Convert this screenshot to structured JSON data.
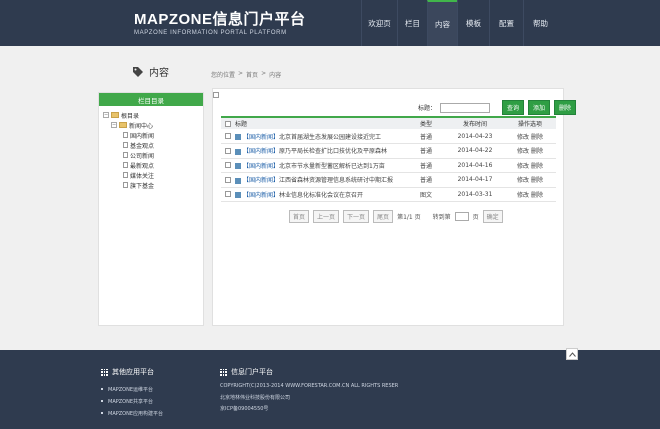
{
  "header": {
    "brand_title": "MAPZONE信息门户平台",
    "brand_subtitle": "MAPZONE INFORMATION PORTAL PLATFORM",
    "nav": [
      "欢迎页",
      "栏目",
      "内容",
      "模板",
      "配置",
      "帮助"
    ],
    "active_nav": "内容",
    "accent": "#41b64b"
  },
  "page": {
    "title": "内容",
    "breadcrumb": [
      "您的位置",
      ">",
      "首页",
      ">",
      "内容"
    ]
  },
  "sidebar": {
    "title": "栏目目录",
    "root": "根目录",
    "group": "新闻中心",
    "items": [
      "国内新闻",
      "基金观点",
      "公司新闻",
      "最新观点",
      "媒体关注",
      "旗下基金"
    ]
  },
  "toolbar": {
    "search_label": "标题：",
    "search_value": "",
    "query_label": "查询",
    "add_label": "添加",
    "delete_label": "删除"
  },
  "table": {
    "headers": [
      "",
      "标题",
      "类型",
      "发布时间",
      "操作选项"
    ],
    "rows": [
      {
        "category": "【国内新闻】",
        "title": "北京首届湖生态发展公园建设接近完工",
        "type": "普通",
        "date": "2014-04-23",
        "edit": "修改",
        "del": "删除"
      },
      {
        "category": "【国内新闻】",
        "title": "原乃平局长检查扩比口技优化及平原森林",
        "type": "普通",
        "date": "2014-04-22",
        "edit": "修改",
        "del": "删除"
      },
      {
        "category": "【国内新闻】",
        "title": "北京市节水量新型蓄区解析已达到1万亩",
        "type": "普通",
        "date": "2014-04-16",
        "edit": "修改",
        "del": "删除"
      },
      {
        "category": "【国内新闻】",
        "title": "江西省森林资源管理信息系统研讨中期汇报",
        "type": "普通",
        "date": "2014-04-17",
        "edit": "修改",
        "del": "删除"
      },
      {
        "category": "【国内新闻】",
        "title": "林业信息化标准化会议在京召开",
        "type": "图文",
        "date": "2014-03-31",
        "edit": "修改",
        "del": "删除"
      }
    ]
  },
  "pager": {
    "first": "首页",
    "prev": "上一页",
    "next": "下一页",
    "last": "尾页",
    "status": "第1/1 页",
    "goto": "转到第",
    "page_unit": "页",
    "confirm": "确定"
  },
  "footer": {
    "col1_title": "其他应用平台",
    "col1_items": [
      "MAPZONE运维平台",
      "MAPZONE共享平台",
      "MAPZONE应用构建平台"
    ],
    "col2_title": "信息门户平台",
    "copyright": "COPYRIGHT(C)2013-2014 WWW.FORESTAR.COM.CN ALL RIGHTS RESER",
    "company": "北京地林伟业科技股份有限公司",
    "icp": "京ICP备09004550号"
  }
}
